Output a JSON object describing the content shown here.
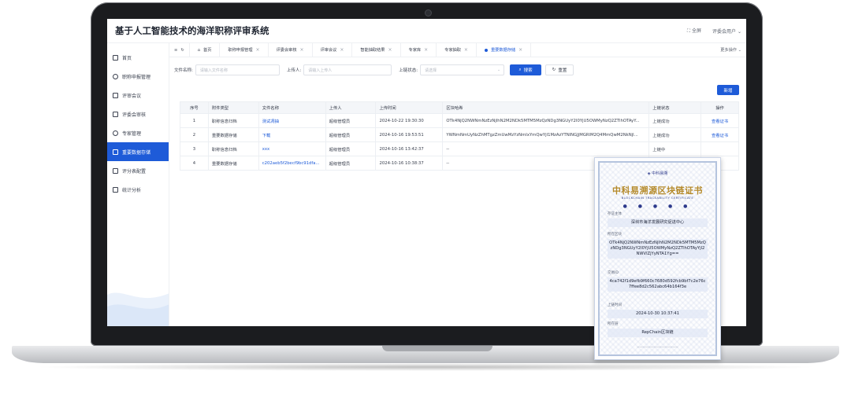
{
  "app": {
    "title": "基于人工智能技术的海洋职称评审系统",
    "fullscreen": "全屏",
    "user": "评委会用户"
  },
  "sidebar": {
    "items": [
      {
        "label": "首页",
        "icon": "home-icon",
        "active": false
      },
      {
        "label": "职称申报管理",
        "icon": "pie-chart-icon",
        "active": false
      },
      {
        "label": "评审会议",
        "icon": "meeting-icon",
        "active": false
      },
      {
        "label": "评委会审核",
        "icon": "review-icon",
        "active": false
      },
      {
        "label": "专家管理",
        "icon": "expert-icon",
        "active": false
      },
      {
        "label": "重要数据存储",
        "icon": "storage-icon",
        "active": true
      },
      {
        "label": "评分表配置",
        "icon": "scoresheet-icon",
        "active": false
      },
      {
        "label": "统计分析",
        "icon": "stats-icon",
        "active": false
      }
    ]
  },
  "tabs": {
    "items": [
      {
        "label": "首页"
      },
      {
        "label": "职称申报管理"
      },
      {
        "label": "评委会审核"
      },
      {
        "label": "评审会议"
      },
      {
        "label": "智能抽取结果"
      },
      {
        "label": "专家库"
      },
      {
        "label": "专家抽取"
      },
      {
        "label": "重要数据存储"
      }
    ],
    "more": "更多操作"
  },
  "filters": {
    "filename_label": "文件名称:",
    "filename_placeholder": "请输入文件名称",
    "uploader_label": "上传人:",
    "uploader_placeholder": "请输入上传人",
    "chain_status_label": "上链状态:",
    "chain_status_placeholder": "请选择",
    "search": "搜索",
    "reset": "重置"
  },
  "actions": {
    "new": "新增"
  },
  "table": {
    "headers": [
      "序号",
      "附件类型",
      "文件名称",
      "上传人",
      "上传时间",
      "区块哈希",
      "上链状态",
      "操作"
    ],
    "rows": [
      {
        "no": "1",
        "type": "职称信息归档",
        "name": "测试凋抽",
        "uploader": "超级管理员",
        "time": "2024-10-22 19:30:30",
        "hash": "OTk4NjQ2NWNmNzEzNjlhN2M2NDk5MTM5MzQzNDg3NGUyY2I0YjU5OWMyNzQ2ZTlhOTAyY...",
        "status": "上链成功",
        "op": "查看证书"
      },
      {
        "no": "2",
        "type": "重要数据存储",
        "name": "下载",
        "uploader": "超级管理员",
        "time": "2024-10-16 19:53:51",
        "hash": "YWNmNmUyNzZhMTgzZmUwMzYzNmIxYmQwYjI1MzAzYTNlNGJjMGRlM2Q4MmQwM2NkNjl...",
        "status": "上链成功",
        "op": "查看证书"
      },
      {
        "no": "3",
        "type": "职称信息归档",
        "name": "xxx",
        "uploader": "超级管理员",
        "time": "2024-10-16 13:42:37",
        "hash": "--",
        "status": "上链中",
        "op": ""
      },
      {
        "no": "4",
        "type": "重要数据存储",
        "name": "c202aeb5f2becf9bc91dfa...",
        "uploader": "超级管理员",
        "time": "2024-10-16 10:38:37",
        "hash": "--",
        "status": "",
        "op": ""
      }
    ]
  },
  "certificate": {
    "brand": "中科易溯",
    "title": "中科易溯源区块链证书",
    "subtitle": "BLOCKCHAIN TRACEABILITY CERTIFICATE",
    "subject_label": "存证主体",
    "subject": "深圳市海洋发展研究促进中心",
    "block_label": "所在区块",
    "block": "OTk4NjQ2NWNmNzEzNjlhN2M2NDk5MTM5MzQzNDg3NGUyY2I0YjU5OWMyNzQ2ZTlhOTAyYjI2NWVlZjYyNTA1Yg==",
    "tx_label": "交易ID",
    "tx": "4ca742f1d9efb9f660c7680d592fcb9bf7c2e76c7ffee8d2c562abc64b164f3e",
    "time_label": "上链时间",
    "time": "2024-10-30 10:37:41",
    "chain_label": "所在链",
    "chain": "RepChain区块链"
  },
  "colors": {
    "accent": "#1e5bd8",
    "gold": "#b58a2a"
  }
}
